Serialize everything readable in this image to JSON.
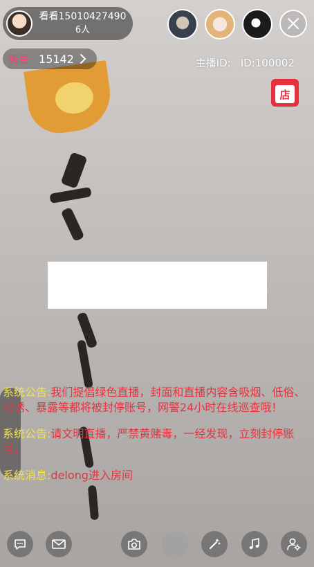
{
  "viewer": {
    "name": "看看15010427490",
    "count": "6人"
  },
  "coins": {
    "label": "秀豆",
    "value": "15142"
  },
  "host": {
    "label": "主播ID:",
    "id": "ID:100002"
  },
  "shop": {
    "label": "店"
  },
  "messages": [
    {
      "tag": "系统公告:",
      "text": "我们提倡绿色直播，封面和直播内容含吸烟、低俗、引诱、暴露等都将被封停账号，网警24小时在线巡查哦！"
    },
    {
      "tag": "系统公告:",
      "text": "请文明直播，严禁黄赌毒，一经发现，立刻封停账号。"
    },
    {
      "tag": "系统消息:",
      "text": "delong进入房间"
    }
  ],
  "colors": {
    "notice_tag": "#f1e24a",
    "notice_text": "#e5333f",
    "coin_label": "#ff3b6b",
    "shop": "#e8303c"
  },
  "icons": [
    "chat-icon",
    "mail-icon",
    "camera-icon",
    "beauty-icon",
    "magic-wand-icon",
    "music-icon",
    "user-settings-icon",
    "close-icon",
    "chevron-right-icon"
  ]
}
